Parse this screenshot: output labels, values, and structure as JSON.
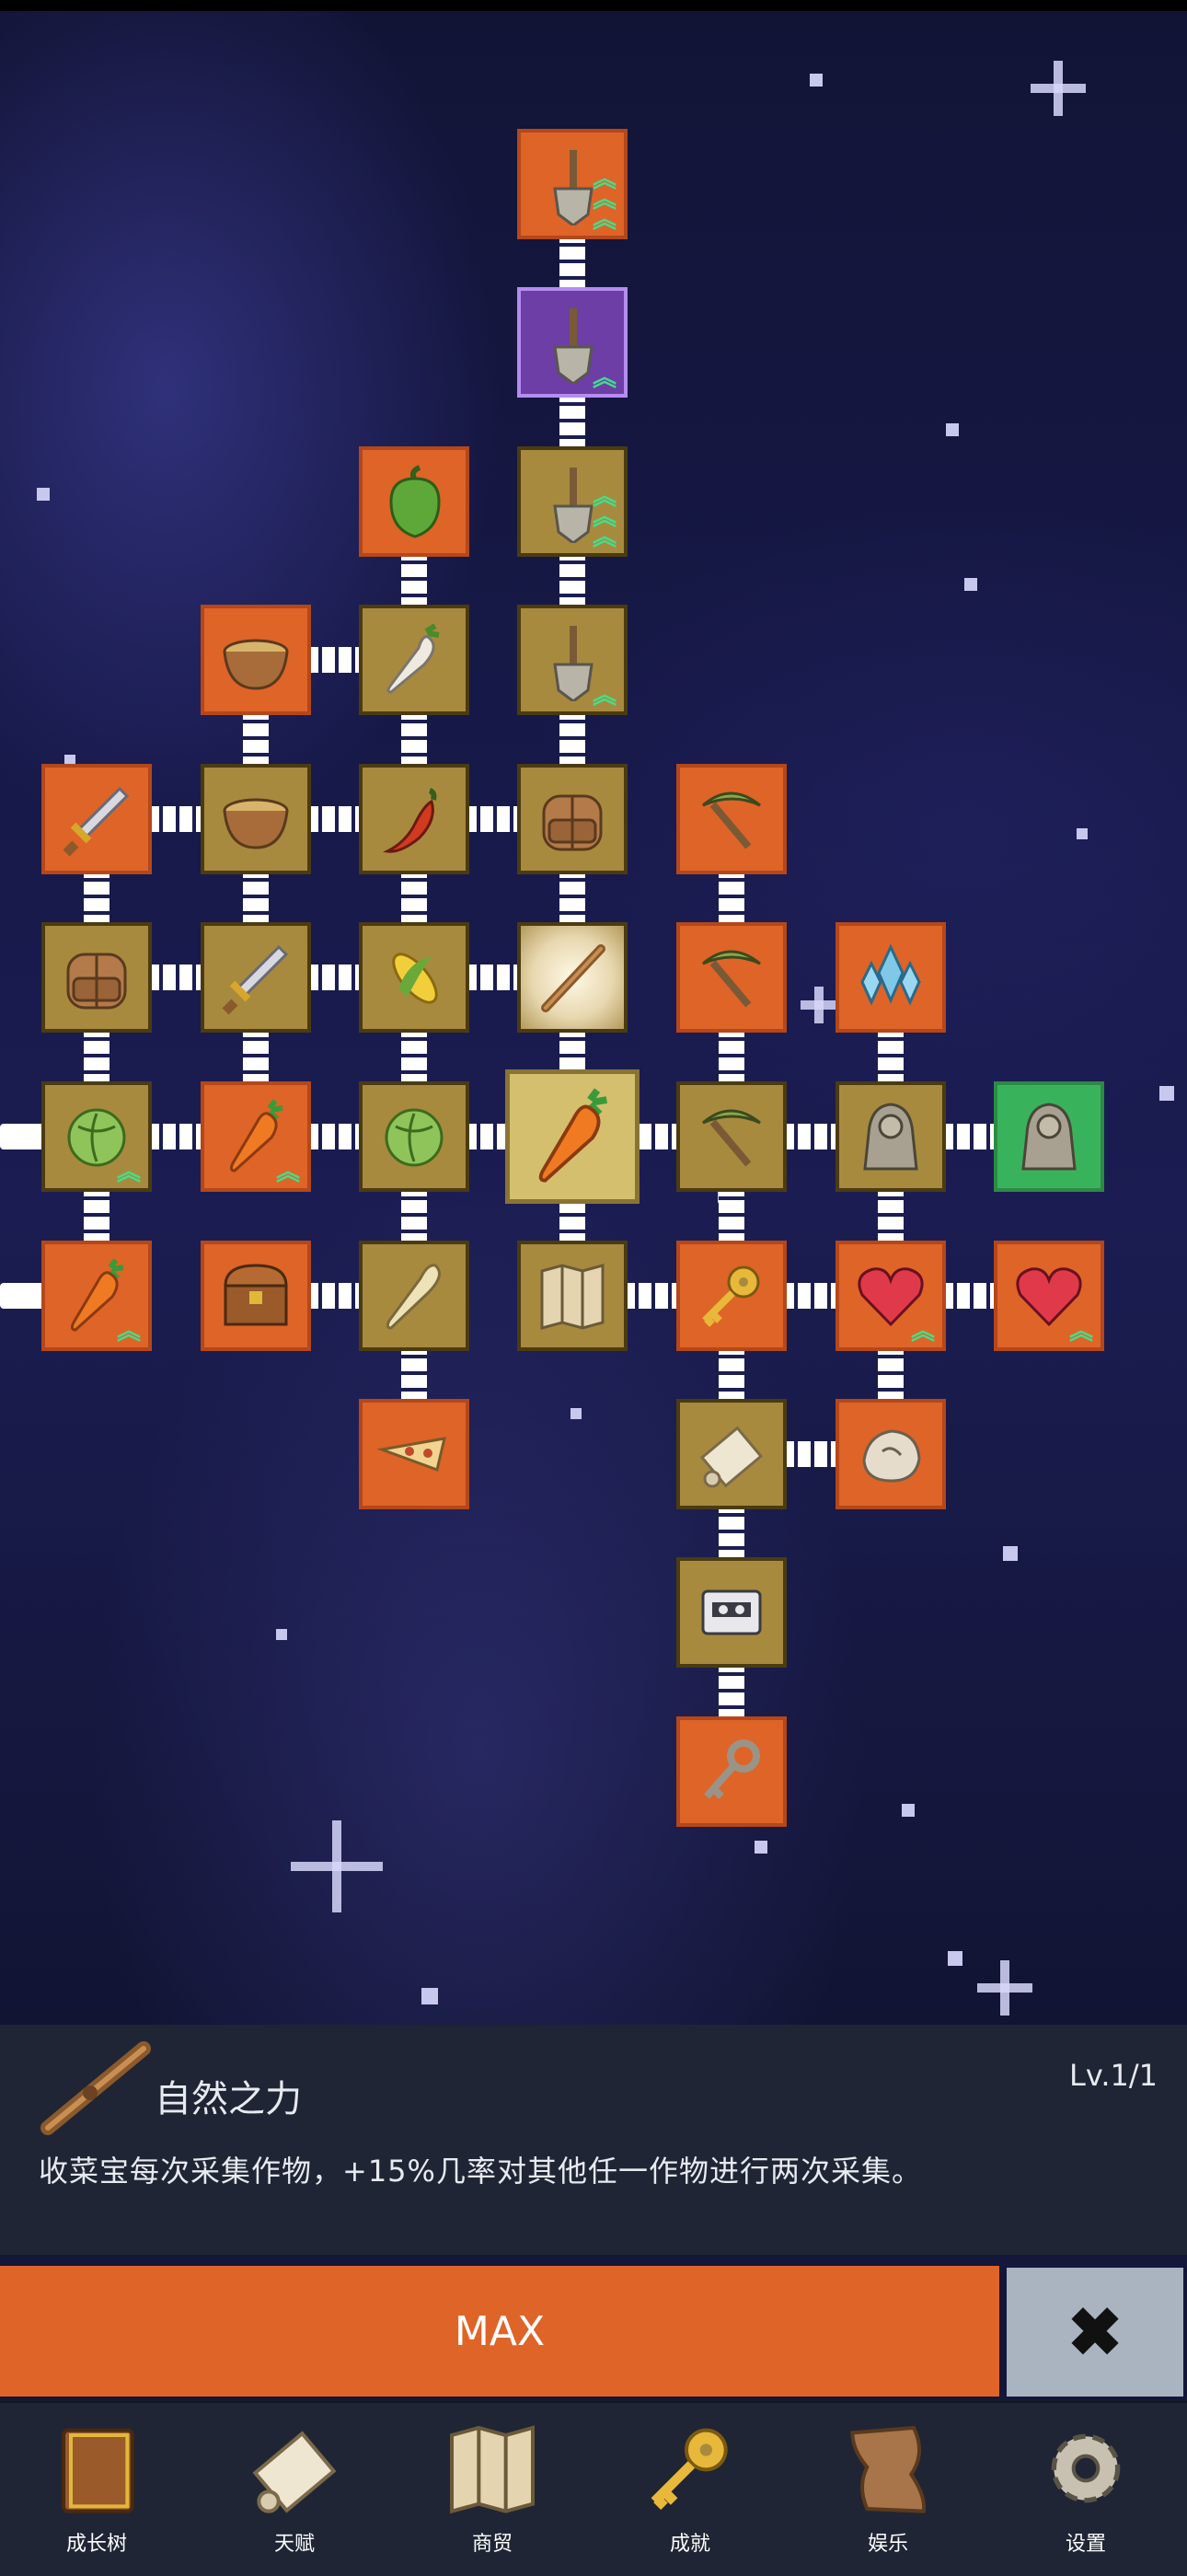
{
  "colors": {
    "node_gold": "#a88a3e",
    "node_orange": "#df6427",
    "node_purple": "#6c3ea6",
    "node_green": "#39b35b",
    "panel_bg": "#1f2534",
    "max_button": "#df6427",
    "close_button": "#a9b4c0",
    "upgrade_arrow": "#3fe08c"
  },
  "tree": {
    "nodes": [
      {
        "icon": "shovel-icon",
        "style": "orange",
        "upgrades": 3
      },
      {
        "icon": "shovel-icon",
        "style": "purple",
        "upgrades": 1
      },
      {
        "icon": "bell-pepper-icon",
        "style": "orange",
        "upgrades": 0
      },
      {
        "icon": "shovel-icon",
        "style": "gold",
        "upgrades": 3
      },
      {
        "icon": "wooden-bowl-icon",
        "style": "orange",
        "upgrades": 0
      },
      {
        "icon": "radish-icon",
        "style": "gold",
        "upgrades": 0
      },
      {
        "icon": "shovel-icon",
        "style": "gold",
        "upgrades": 1
      },
      {
        "icon": "sword-icon",
        "style": "orange",
        "upgrades": 0
      },
      {
        "icon": "wooden-bowl-icon",
        "style": "gold",
        "upgrades": 0
      },
      {
        "icon": "chili-pepper-icon",
        "style": "gold",
        "upgrades": 0
      },
      {
        "icon": "backpack-icon",
        "style": "gold",
        "upgrades": 0
      },
      {
        "icon": "pickaxe-icon",
        "style": "orange",
        "upgrades": 0
      },
      {
        "icon": "backpack-icon",
        "style": "gold",
        "upgrades": 0
      },
      {
        "icon": "sword-icon",
        "style": "gold",
        "upgrades": 0
      },
      {
        "icon": "corn-icon",
        "style": "gold",
        "upgrades": 0
      },
      {
        "icon": "wand-icon",
        "style": "glow",
        "upgrades": 0
      },
      {
        "icon": "pickaxe-icon",
        "style": "orange",
        "upgrades": 0
      },
      {
        "icon": "crystal-icon",
        "style": "orange",
        "upgrades": 0
      },
      {
        "icon": "cabbage-icon",
        "style": "gold",
        "upgrades": 1
      },
      {
        "icon": "carrot-icon",
        "style": "orange",
        "upgrades": 1
      },
      {
        "icon": "cabbage-icon",
        "style": "gold",
        "upgrades": 0
      },
      {
        "icon": "carrot-icon",
        "style": "selected",
        "upgrades": 0
      },
      {
        "icon": "pickaxe-icon",
        "style": "gold",
        "upgrades": 0
      },
      {
        "icon": "statue-icon",
        "style": "gold",
        "upgrades": 0
      },
      {
        "icon": "statue-icon",
        "style": "green",
        "upgrades": 0
      },
      {
        "icon": "carrot-icon",
        "style": "orange",
        "upgrades": 1
      },
      {
        "icon": "treasure-chest-icon",
        "style": "orange",
        "upgrades": 0
      },
      {
        "icon": "parsnip-icon",
        "style": "gold",
        "upgrades": 0
      },
      {
        "icon": "map-icon",
        "style": "gold",
        "upgrades": 0
      },
      {
        "icon": "key-icon",
        "style": "orange",
        "upgrades": 0
      },
      {
        "icon": "heart-icon",
        "style": "orange",
        "upgrades": 1
      },
      {
        "icon": "heart-icon",
        "style": "orange",
        "upgrades": 1
      },
      {
        "icon": "pizza-icon",
        "style": "orange",
        "upgrades": 0
      },
      {
        "icon": "scroll-icon",
        "style": "gold",
        "upgrades": 0
      },
      {
        "icon": "ore-icon",
        "style": "orange",
        "upgrades": 0
      },
      {
        "icon": "cassette-icon",
        "style": "gold",
        "upgrades": 0
      },
      {
        "icon": "old-key-icon",
        "style": "orange",
        "upgrades": 0
      }
    ]
  },
  "detail": {
    "icon": "wand-icon",
    "name": "自然之力",
    "level": "Lv.1/1",
    "description": "收菜宝每次采集作物，+15%几率对其他任一作物进行两次采集。"
  },
  "actions": {
    "max_label": "MAX",
    "close_icon": "close-icon"
  },
  "nav": [
    {
      "label": "成长树",
      "icon": "book-icon"
    },
    {
      "label": "天赋",
      "icon": "scroll-icon"
    },
    {
      "label": "商贸",
      "icon": "map-icon"
    },
    {
      "label": "成就",
      "icon": "key-icon"
    },
    {
      "label": "娱乐",
      "icon": "paper-icon"
    },
    {
      "label": "设置",
      "icon": "gear-icon"
    }
  ]
}
